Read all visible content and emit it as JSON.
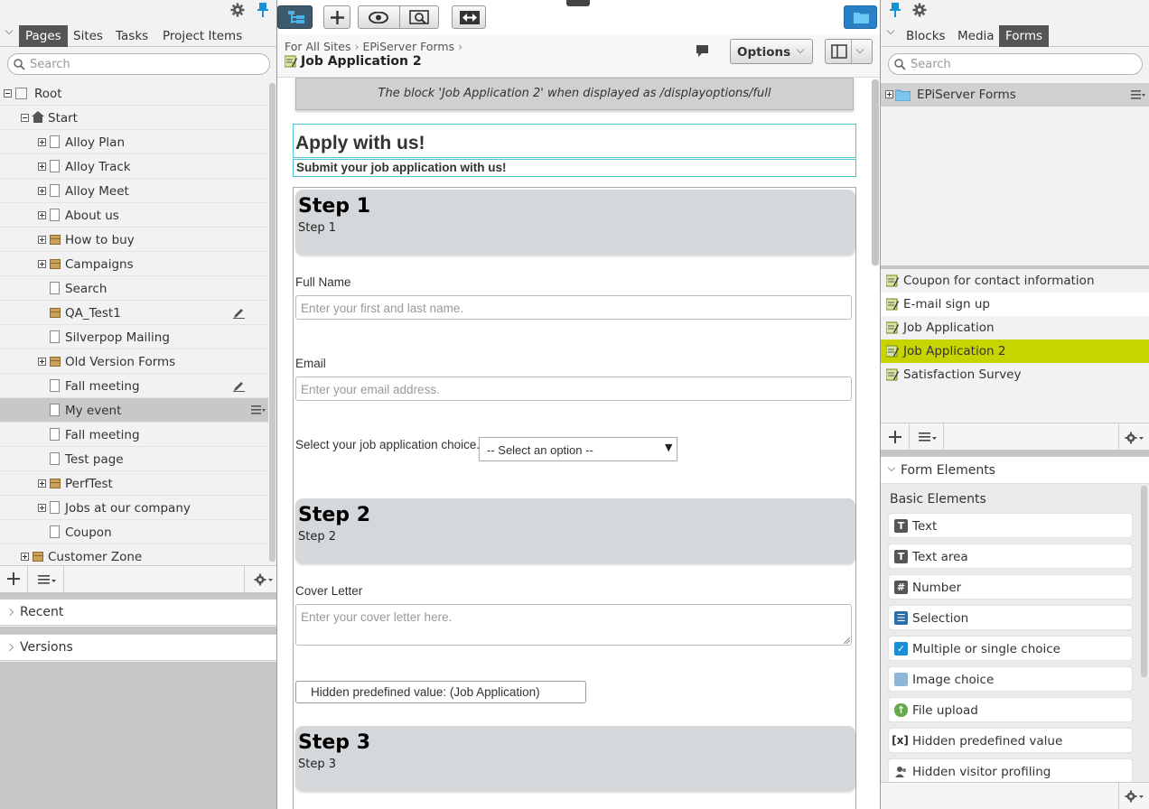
{
  "left": {
    "tabs": [
      "Pages",
      "Sites",
      "Tasks",
      "Project Items"
    ],
    "search_placeholder": "Search",
    "tree": [
      {
        "label": "Root"
      },
      {
        "label": "Start"
      },
      {
        "label": "Alloy Plan"
      },
      {
        "label": "Alloy Track"
      },
      {
        "label": "Alloy Meet"
      },
      {
        "label": "About us"
      },
      {
        "label": "How to buy"
      },
      {
        "label": "Campaigns"
      },
      {
        "label": "Search"
      },
      {
        "label": "QA_Test1"
      },
      {
        "label": "Silverpop Mailing"
      },
      {
        "label": "Old Version Forms"
      },
      {
        "label": "Fall meeting"
      },
      {
        "label": "My event"
      },
      {
        "label": "Fall meeting"
      },
      {
        "label": "Test page"
      },
      {
        "label": "PerfTest"
      },
      {
        "label": "Jobs at our company"
      },
      {
        "label": "Coupon"
      },
      {
        "label": "Customer Zone"
      }
    ],
    "recent": "Recent",
    "versions": "Versions"
  },
  "center": {
    "breadcrumb": [
      "For All Sites",
      "EPiServer Forms"
    ],
    "page_title": "Job Application 2",
    "options_label": "Options",
    "display_note": "The block 'Job Application 2' when displayed as /displayoptions/full",
    "form_title": "Apply with us!",
    "form_subtitle": "Submit your job application with us!",
    "steps": [
      {
        "title": "Step 1",
        "sub": "Step 1"
      },
      {
        "title": "Step 2",
        "sub": "Step 2"
      },
      {
        "title": "Step 3",
        "sub": "Step 3"
      }
    ],
    "fields": {
      "fullname_label": "Full Name",
      "fullname_ph": "Enter your first and last name.",
      "email_label": "Email",
      "email_ph": "Enter your email address.",
      "choice_label": "Select your job application choice.",
      "choice_selected": "-- Select an option --",
      "cover_label": "Cover Letter",
      "cover_ph": "Enter your cover letter here.",
      "hidden_value": "Hidden predefined value: (Job Application)"
    }
  },
  "right": {
    "tabs": [
      "Blocks",
      "Media",
      "Forms"
    ],
    "search_placeholder": "Search",
    "folder": "EPiServer Forms",
    "forms": [
      "Coupon for contact information",
      "E-mail sign up",
      "Job Application",
      "Job Application 2",
      "Satisfaction Survey"
    ],
    "form_elements_title": "Form Elements",
    "basic_elements_title": "Basic Elements",
    "elements": [
      {
        "label": "Text",
        "icon": "text-icon"
      },
      {
        "label": "Text area",
        "icon": "textarea-icon"
      },
      {
        "label": "Number",
        "icon": "number-icon"
      },
      {
        "label": "Selection",
        "icon": "selection-icon"
      },
      {
        "label": "Multiple or single choice",
        "icon": "checkbox-icon"
      },
      {
        "label": "Image choice",
        "icon": "image-icon"
      },
      {
        "label": "File upload",
        "icon": "upload-icon"
      },
      {
        "label": "Hidden predefined value",
        "icon": "hidden-value-icon"
      },
      {
        "label": "Hidden visitor profiling",
        "icon": "visitor-icon"
      }
    ],
    "selected_color": "#c8d400"
  }
}
